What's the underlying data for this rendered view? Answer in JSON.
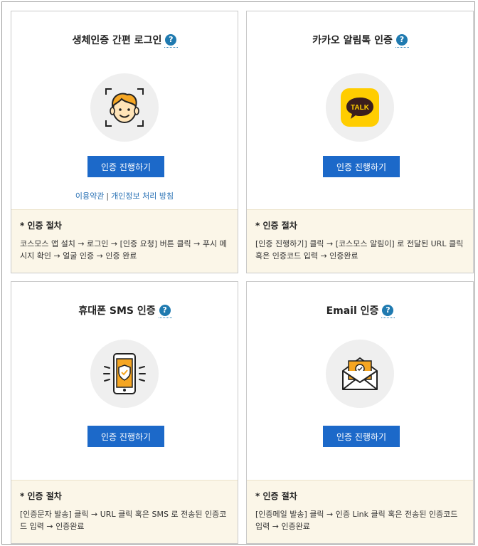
{
  "cards": [
    {
      "title": "생체인증 간편 로그인",
      "help": "?",
      "icon": "face-id-icon",
      "button": "인증 진행하기",
      "links": {
        "terms": "이용약관",
        "separator": "|",
        "privacy": "개인정보 처리 방침"
      },
      "procedure_title": "* 인증 절차",
      "procedure_desc": "코스모스 앱 설치 → 로그인 → [인증 요청] 버튼 클릭 → 푸시 메시지 확인 → 얼굴 인증 → 인증 완료"
    },
    {
      "title": "카카오 알림톡 인증",
      "help": "?",
      "icon": "kakaotalk-icon",
      "icon_text": "TALK",
      "button": "인증 진행하기",
      "procedure_title": "* 인증 절차",
      "procedure_desc": "[인증 진행하기] 클릭 → [코스모스 알림이] 로 전달된 URL 클릭 혹은 인증코드 입력 → 인증완료"
    },
    {
      "title": "휴대폰 SMS 인증",
      "help": "?",
      "icon": "smartphone-shield-icon",
      "button": "인증 진행하기",
      "procedure_title": "* 인증 절차",
      "procedure_desc": "[인증문자 발송] 클릭 → URL 클릭 혹은 SMS 로 전송된 인증코드 입력 → 인증완료"
    },
    {
      "title": "Email 인증",
      "help": "?",
      "icon": "email-envelope-icon",
      "button": "인증 진행하기",
      "procedure_title": "* 인증 절차",
      "procedure_desc": "[인증메일 발송] 클릭 → 인증 Link 클릭 혹은 전송된 인증코드 입력 → 인증완료"
    }
  ],
  "colors": {
    "button": "#1c69c9",
    "help": "#1f7ab0",
    "kakao_yellow": "#ffcd00",
    "procedure_bg": "#fbf6e8",
    "icon_orange": "#f5a623"
  }
}
